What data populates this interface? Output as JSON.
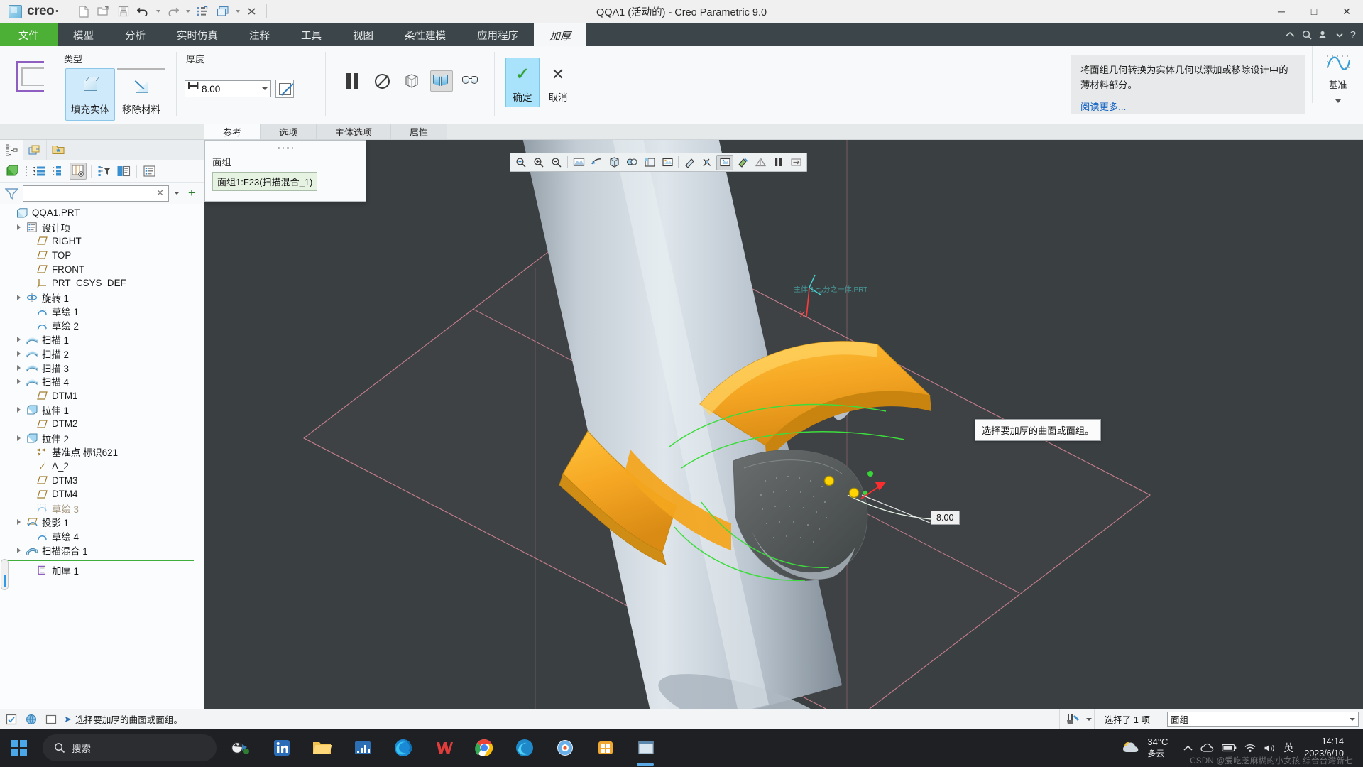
{
  "titlebar": {
    "app_name": "creo",
    "title": "QQA1 (活动的) - Creo Parametric 9.0",
    "qat": [
      {
        "name": "new-file",
        "icon": "page-icon"
      },
      {
        "name": "open-file",
        "icon": "folder-open-icon"
      },
      {
        "name": "save-file",
        "icon": "save-icon"
      },
      {
        "name": "undo",
        "icon": "undo-icon"
      },
      {
        "name": "redo",
        "icon": "redo-icon"
      },
      {
        "name": "regenerate",
        "icon": "regenerate-icon"
      },
      {
        "name": "window-switch",
        "icon": "window-icon"
      },
      {
        "name": "close-window",
        "icon": "close-x-icon"
      }
    ],
    "window_controls": {
      "minimize": "─",
      "maximize": "□",
      "close": "✕"
    }
  },
  "ribbon_tabs": [
    {
      "label": "文件",
      "kind": "file"
    },
    {
      "label": "模型",
      "kind": "normal"
    },
    {
      "label": "分析",
      "kind": "normal"
    },
    {
      "label": "实时仿真",
      "kind": "normal"
    },
    {
      "label": "注释",
      "kind": "normal"
    },
    {
      "label": "工具",
      "kind": "normal"
    },
    {
      "label": "视图",
      "kind": "normal"
    },
    {
      "label": "柔性建模",
      "kind": "normal"
    },
    {
      "label": "应用程序",
      "kind": "normal"
    },
    {
      "label": "加厚",
      "kind": "context"
    }
  ],
  "ribbon": {
    "type_group": {
      "label": "类型",
      "buttons": [
        {
          "label": "填充实体",
          "selected": true,
          "icon": "fill-solid-icon"
        },
        {
          "label": "移除材料",
          "selected": false,
          "icon": "remove-material-icon"
        }
      ]
    },
    "thickness_group": {
      "label": "厚度",
      "value": "8.00",
      "flip_icon": "flip-direction-icon"
    },
    "controls": [
      {
        "name": "pause-button",
        "icon": "pause-icon",
        "active": false
      },
      {
        "name": "no-preview-button",
        "icon": "no-preview-icon",
        "active": false
      },
      {
        "name": "wireframe-preview-button",
        "icon": "wireframe-icon",
        "active": false
      },
      {
        "name": "solid-preview-button",
        "icon": "solid-preview-icon",
        "active": true
      },
      {
        "name": "glasses-preview-button",
        "icon": "glasses-icon",
        "active": false
      }
    ],
    "confirm": {
      "label": "确定",
      "icon": "check-icon"
    },
    "cancel": {
      "label": "取消",
      "icon": "x-icon"
    },
    "help": {
      "text": "将面组几何转换为实体几何以添加或移除设计中的薄材料部分。",
      "link": "阅读更多..."
    },
    "datum": {
      "label": "基准",
      "icon": "datum-curve-icon"
    }
  },
  "dashboard_tabs": [
    {
      "label": "参考",
      "active": true
    },
    {
      "label": "选项",
      "active": false
    },
    {
      "label": "主体选项",
      "active": false
    },
    {
      "label": "属性",
      "active": false
    }
  ],
  "reference_popup": {
    "label": "面组",
    "item": "面组1:F23(扫描混合_1)"
  },
  "left_pane": {
    "nav_tabs": [
      {
        "name": "model-tree-tab",
        "icon": "tree-icon",
        "active": true
      },
      {
        "name": "layers-tab",
        "icon": "layers-icon",
        "active": false
      },
      {
        "name": "folder-browser-tab",
        "icon": "folder-star-icon",
        "active": false
      }
    ],
    "toolbar": [
      {
        "name": "model-display-button",
        "icon": "green-cube-icon"
      },
      {
        "name": "expand-all-button",
        "icon": "list-expand-icon"
      },
      {
        "name": "collapse-all-button",
        "icon": "list-collapse-icon"
      },
      {
        "name": "tree-columns-button",
        "icon": "tree-columns-icon",
        "active": true
      },
      {
        "name": "tree-filters-button",
        "icon": "tree-filter-icon"
      },
      {
        "name": "copy-tree-button",
        "icon": "copy-tree-icon"
      },
      {
        "name": "settings-button",
        "icon": "settings-list-icon"
      }
    ],
    "filter": {
      "value": "",
      "placeholder": ""
    },
    "tree": [
      {
        "label": "QQA1.PRT",
        "indent": 0,
        "icon": "part-icon",
        "arrow": false
      },
      {
        "label": "设计项",
        "indent": 1,
        "icon": "design-items-icon",
        "arrow": true
      },
      {
        "label": "RIGHT",
        "indent": 2,
        "icon": "datum-plane-icon",
        "arrow": false
      },
      {
        "label": "TOP",
        "indent": 2,
        "icon": "datum-plane-icon",
        "arrow": false
      },
      {
        "label": "FRONT",
        "indent": 2,
        "icon": "datum-plane-icon",
        "arrow": false
      },
      {
        "label": "PRT_CSYS_DEF",
        "indent": 2,
        "icon": "csys-icon",
        "arrow": false
      },
      {
        "label": "旋转 1",
        "indent": 1,
        "icon": "revolve-icon",
        "arrow": true
      },
      {
        "label": "草绘 1",
        "indent": 2,
        "icon": "sketch-icon",
        "arrow": false
      },
      {
        "label": "草绘 2",
        "indent": 2,
        "icon": "sketch-icon",
        "arrow": false
      },
      {
        "label": "扫描 1",
        "indent": 1,
        "icon": "sweep-icon",
        "arrow": true
      },
      {
        "label": "扫描 2",
        "indent": 1,
        "icon": "sweep-icon",
        "arrow": true
      },
      {
        "label": "扫描 3",
        "indent": 1,
        "icon": "sweep-icon",
        "arrow": true
      },
      {
        "label": "扫描 4",
        "indent": 1,
        "icon": "sweep-icon",
        "arrow": true
      },
      {
        "label": "DTM1",
        "indent": 2,
        "icon": "datum-plane-icon",
        "arrow": false
      },
      {
        "label": "拉伸 1",
        "indent": 1,
        "icon": "extrude-icon",
        "arrow": true
      },
      {
        "label": "DTM2",
        "indent": 2,
        "icon": "datum-plane-icon",
        "arrow": false
      },
      {
        "label": "拉伸 2",
        "indent": 1,
        "icon": "extrude-icon",
        "arrow": true
      },
      {
        "label": "基准点 标识621",
        "indent": 2,
        "icon": "datum-point-icon",
        "arrow": false
      },
      {
        "label": "A_2",
        "indent": 2,
        "icon": "axis-icon",
        "arrow": false
      },
      {
        "label": "DTM3",
        "indent": 2,
        "icon": "datum-plane-icon",
        "arrow": false
      },
      {
        "label": "DTM4",
        "indent": 2,
        "icon": "datum-plane-icon",
        "arrow": false
      },
      {
        "label": "草绘 3",
        "indent": 2,
        "icon": "sketch-icon",
        "arrow": false,
        "dim": true
      },
      {
        "label": "投影 1",
        "indent": 1,
        "icon": "project-icon",
        "arrow": true
      },
      {
        "label": "草绘 4",
        "indent": 2,
        "icon": "sketch-icon",
        "arrow": false
      },
      {
        "label": "扫描混合 1",
        "indent": 1,
        "icon": "swept-blend-icon",
        "arrow": true
      },
      {
        "label": "加厚 1",
        "indent": 2,
        "icon": "thicken-icon",
        "arrow": false,
        "insert": true
      }
    ]
  },
  "viewport": {
    "toolbar": [
      {
        "name": "refit-zoom-button",
        "icon": "zoom-fit-icon"
      },
      {
        "name": "zoom-in-button",
        "icon": "zoom-in-icon"
      },
      {
        "name": "zoom-out-button",
        "icon": "zoom-out-icon"
      },
      {
        "name": "repaint-button",
        "icon": "repaint-icon"
      },
      {
        "name": "view-orientation-button",
        "icon": "orient-icon"
      },
      {
        "name": "saved-views-button",
        "icon": "saved-view-icon"
      },
      {
        "name": "display-style-button",
        "icon": "display-style-icon"
      },
      {
        "name": "layer-display-button",
        "icon": "layer-display-icon"
      },
      {
        "name": "datum-display-button",
        "icon": "datum-display-icon"
      },
      {
        "name": "appearance-button",
        "icon": "appearance-icon"
      },
      {
        "name": "annotation-display-button",
        "icon": "annotation-icon"
      },
      {
        "name": "spin-center-button",
        "icon": "spin-center-icon",
        "active": true
      },
      {
        "name": "section-button",
        "icon": "section-icon"
      },
      {
        "name": "perspective-button",
        "icon": "perspective-icon"
      },
      {
        "name": "pause-view-button",
        "icon": "pause-icon"
      },
      {
        "name": "more-views-button",
        "icon": "more-icon"
      }
    ],
    "tooltip": "选择要加厚的曲面或面组。",
    "dimension_badge": "8.00",
    "csys_label_x": "X"
  },
  "statusbar": {
    "icons": [
      {
        "name": "regen-status-icon"
      },
      {
        "name": "globe-icon"
      },
      {
        "name": "window-icon"
      }
    ],
    "message": "选择要加厚的曲面或面组。",
    "selection_count": "选择了 1 项",
    "filter_value": "面组"
  },
  "taskbar": {
    "search_placeholder": "搜索",
    "apps": [
      {
        "name": "taskview-icon"
      },
      {
        "name": "linkedin-icon"
      },
      {
        "name": "explorer-icon"
      },
      {
        "name": "stock-app-icon"
      },
      {
        "name": "edge-icon"
      },
      {
        "name": "wps-icon"
      },
      {
        "name": "chrome-icon"
      },
      {
        "name": "edge-dev-icon"
      },
      {
        "name": "office-icon"
      },
      {
        "name": "store-icon"
      },
      {
        "name": "creo-app-icon"
      }
    ],
    "weather": {
      "temp": "34°C",
      "desc": "多云"
    },
    "clock": {
      "time": "14:14",
      "date": "2023/6/10"
    },
    "watermark": "CSDN @爱吃芝麻糊的小女孩 综合台灣新七"
  }
}
